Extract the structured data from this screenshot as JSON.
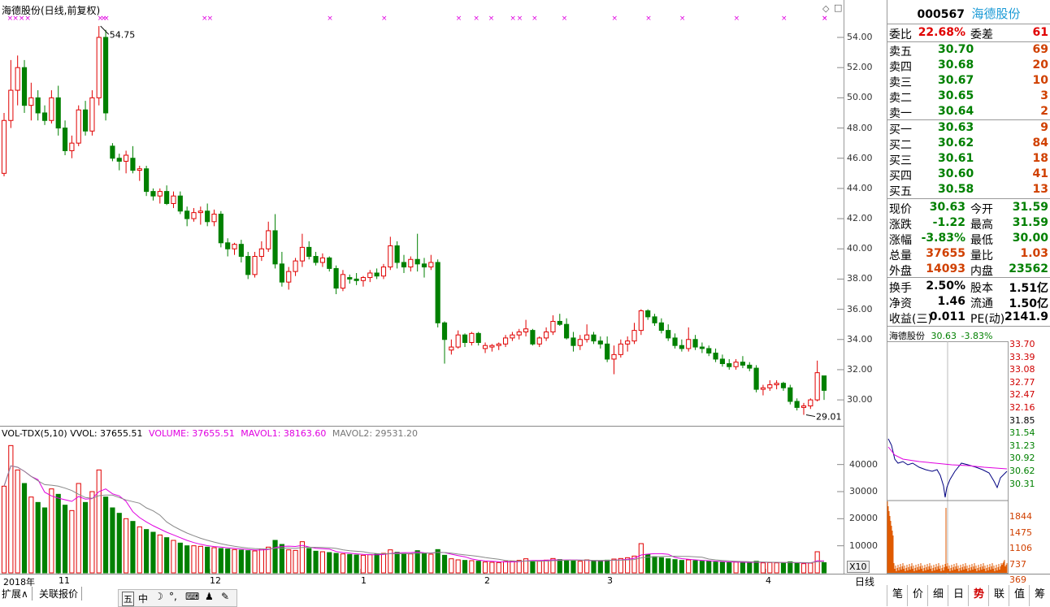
{
  "chart_header": {
    "title": "海德股份(日线,前复权)",
    "high_label": "54.75",
    "low_label": "29.01"
  },
  "indicator_header": {
    "name": "VOL-TDX(5,10)",
    "vvol": "VVOL: 37655.51",
    "volume": "VOLUME: 37655.51",
    "mavol1": "MAVOL1: 38163.60",
    "mavol2": "MAVOL2: 29531.20"
  },
  "colors": {
    "up": "#e00000",
    "down": "#008000",
    "ma1": "#e000e0",
    "ma2": "#888888",
    "grid": "#c8c8c8"
  },
  "price_axis": [
    "54.00",
    "52.00",
    "50.00",
    "48.00",
    "46.00",
    "44.00",
    "42.00",
    "40.00",
    "38.00",
    "36.00",
    "34.00",
    "32.00",
    "30.00"
  ],
  "volume_axis": [
    "40000",
    "30000",
    "20000",
    "10000"
  ],
  "volume_scale_badge": "X10",
  "time_axis": [
    "2018年",
    "11",
    "12",
    "1",
    "2",
    "3",
    "4"
  ],
  "period_label": "日线",
  "bottom_tabs": [
    "扩展∧",
    "关联报价"
  ],
  "toolbar_icons": [
    "五",
    "中",
    "moon-icon",
    "dots-icon",
    "keyboard-icon",
    "person-icon",
    "wrench-icon"
  ],
  "stock": {
    "code": "000567",
    "name": "海德股份"
  },
  "order_book": {
    "weibi_label": "委比",
    "weibi": "22.68%",
    "weicha_label": "委差",
    "weicha": "61",
    "asks": [
      {
        "label": "卖五",
        "price": "30.70",
        "vol": "69"
      },
      {
        "label": "卖四",
        "price": "30.68",
        "vol": "20"
      },
      {
        "label": "卖三",
        "price": "30.67",
        "vol": "10"
      },
      {
        "label": "卖二",
        "price": "30.65",
        "vol": "3"
      },
      {
        "label": "卖一",
        "price": "30.64",
        "vol": "2"
      }
    ],
    "bids": [
      {
        "label": "买一",
        "price": "30.63",
        "vol": "9"
      },
      {
        "label": "买二",
        "price": "30.62",
        "vol": "84"
      },
      {
        "label": "买三",
        "price": "30.61",
        "vol": "18"
      },
      {
        "label": "买四",
        "price": "30.60",
        "vol": "41"
      },
      {
        "label": "买五",
        "price": "30.58",
        "vol": "13"
      }
    ]
  },
  "quote": [
    {
      "l": "现价",
      "v": "30.63",
      "l2": "今开",
      "v2": "31.59"
    },
    {
      "l": "涨跌",
      "v": "-1.22",
      "l2": "最高",
      "v2": "31.59"
    },
    {
      "l": "涨幅",
      "v": "-3.83%",
      "l2": "最低",
      "v2": "30.00"
    },
    {
      "l": "总量",
      "v": "37655",
      "l2": "量比",
      "v2": "1.03"
    },
    {
      "l": "外盘",
      "v": "14093",
      "l2": "内盘",
      "v2": "23562"
    }
  ],
  "fundamentals": [
    {
      "l": "换手",
      "v": "2.50%",
      "l2": "股本",
      "v2": "1.51亿"
    },
    {
      "l": "净资",
      "v": "1.46",
      "l2": "流通",
      "v2": "1.50亿"
    },
    {
      "l": "收益(三)",
      "v": "0.011",
      "l2": "PE(动)",
      "v2": "2141.9"
    }
  ],
  "mini_chart": {
    "header_name": "海德股份",
    "header_value": "30.63",
    "header_change": "-3.83%",
    "price_ticks": [
      "33.70",
      "33.39",
      "33.08",
      "32.77",
      "32.47",
      "32.16",
      "31.85",
      "31.54",
      "31.23",
      "30.92",
      "30.62",
      "30.31"
    ],
    "vol_ticks": [
      "1844",
      "1475",
      "1106",
      "737",
      "369"
    ]
  },
  "right_tabs": [
    "笔",
    "价",
    "细",
    "日",
    "势",
    "联",
    "值",
    "筹"
  ],
  "active_right_tab": "势",
  "chart_data": {
    "type": "candlestick",
    "title": "海德股份(日线,前复权)",
    "ylim": [
      28.5,
      55.4
    ],
    "ohlc": [
      [
        45.0,
        49.0,
        44.8,
        48.5
      ],
      [
        48.5,
        52.5,
        48.0,
        50.5
      ],
      [
        50.5,
        52.8,
        49.5,
        52.0
      ],
      [
        52.0,
        52.5,
        49.0,
        49.5
      ],
      [
        49.5,
        51.0,
        48.5,
        50.0
      ],
      [
        50.0,
        50.5,
        48.5,
        49.0
      ],
      [
        49.0,
        49.5,
        48.2,
        48.5
      ],
      [
        48.5,
        50.5,
        48.3,
        50.0
      ],
      [
        50.0,
        50.8,
        47.5,
        48.0
      ],
      [
        48.0,
        48.5,
        46.2,
        46.5
      ],
      [
        46.5,
        47.5,
        46.0,
        47.0
      ],
      [
        47.0,
        49.5,
        46.8,
        49.2
      ],
      [
        49.2,
        49.8,
        47.5,
        47.8
      ],
      [
        47.8,
        50.5,
        47.5,
        50.0
      ],
      [
        50.0,
        54.75,
        49.5,
        54.0
      ],
      [
        54.0,
        54.5,
        48.5,
        49.0
      ],
      [
        46.8,
        47.0,
        45.8,
        46.0
      ],
      [
        46.0,
        46.3,
        45.2,
        45.8
      ],
      [
        45.8,
        46.5,
        45.0,
        46.2
      ],
      [
        46.0,
        46.8,
        45.0,
        45.2
      ],
      [
        45.2,
        45.5,
        44.5,
        45.3
      ],
      [
        45.3,
        45.5,
        43.5,
        43.8
      ],
      [
        43.8,
        44.0,
        43.2,
        43.5
      ],
      [
        43.5,
        44.0,
        43.0,
        43.8
      ],
      [
        43.8,
        44.2,
        42.9,
        43.0
      ],
      [
        43.0,
        43.8,
        42.7,
        43.5
      ],
      [
        43.5,
        43.8,
        42.3,
        42.5
      ],
      [
        42.5,
        42.8,
        41.5,
        42.0
      ],
      [
        42.0,
        42.7,
        41.8,
        42.4
      ],
      [
        42.4,
        42.8,
        41.6,
        42.5
      ],
      [
        42.5,
        43.0,
        41.5,
        41.8
      ],
      [
        41.8,
        42.6,
        41.5,
        42.3
      ],
      [
        42.3,
        42.5,
        40.1,
        40.4
      ],
      [
        40.4,
        40.7,
        39.5,
        40.0
      ],
      [
        40.0,
        40.4,
        39.6,
        40.3
      ],
      [
        40.3,
        40.6,
        39.1,
        39.5
      ],
      [
        39.5,
        39.8,
        38.0,
        38.3
      ],
      [
        38.3,
        39.8,
        38.1,
        39.5
      ],
      [
        39.5,
        40.5,
        39.2,
        40.0
      ],
      [
        40.0,
        41.8,
        39.8,
        41.2
      ],
      [
        41.2,
        42.3,
        38.7,
        39.0
      ],
      [
        39.0,
        39.8,
        37.5,
        37.8
      ],
      [
        37.8,
        38.8,
        37.3,
        38.5
      ],
      [
        38.5,
        39.4,
        38.2,
        39.2
      ],
      [
        39.2,
        41.0,
        38.8,
        40.1
      ],
      [
        40.1,
        40.5,
        39.3,
        39.5
      ],
      [
        39.5,
        39.8,
        38.9,
        39.1
      ],
      [
        39.1,
        39.7,
        38.8,
        39.4
      ],
      [
        39.4,
        39.5,
        38.5,
        38.7
      ],
      [
        38.7,
        38.9,
        37.0,
        37.4
      ],
      [
        37.4,
        38.6,
        37.2,
        38.3
      ],
      [
        38.1,
        38.3,
        37.7,
        38.0
      ],
      [
        38.0,
        38.4,
        37.6,
        37.9
      ],
      [
        37.9,
        38.2,
        37.5,
        38.1
      ],
      [
        38.1,
        38.6,
        37.8,
        38.4
      ],
      [
        38.4,
        38.7,
        38.0,
        38.2
      ],
      [
        38.2,
        39.0,
        38.0,
        38.8
      ],
      [
        38.8,
        40.8,
        38.6,
        40.2
      ],
      [
        40.2,
        40.5,
        38.7,
        39.1
      ],
      [
        39.1,
        39.6,
        38.4,
        38.8
      ],
      [
        38.8,
        39.5,
        38.5,
        39.3
      ],
      [
        39.3,
        41.0,
        38.5,
        39.0
      ],
      [
        39.0,
        39.4,
        38.1,
        38.8
      ],
      [
        38.8,
        39.6,
        38.6,
        39.1
      ],
      [
        39.1,
        39.3,
        34.8,
        35.1
      ],
      [
        35.1,
        35.2,
        32.4,
        34.0
      ],
      [
        33.3,
        34.0,
        33.0,
        33.5
      ],
      [
        33.5,
        34.6,
        33.4,
        34.3
      ],
      [
        34.3,
        34.4,
        33.5,
        33.8
      ],
      [
        33.8,
        34.5,
        33.6,
        34.4
      ],
      [
        34.4,
        34.5,
        33.6,
        33.8
      ],
      [
        33.4,
        33.8,
        33.1,
        33.6
      ],
      [
        33.5,
        33.7,
        33.2,
        33.6
      ],
      [
        33.6,
        33.8,
        33.3,
        33.7
      ],
      [
        33.7,
        34.3,
        33.5,
        34.1
      ],
      [
        34.1,
        34.5,
        33.9,
        34.3
      ],
      [
        34.3,
        34.7,
        34.0,
        34.5
      ],
      [
        34.5,
        35.3,
        34.2,
        34.7
      ],
      [
        34.6,
        34.7,
        33.6,
        33.7
      ],
      [
        33.7,
        34.2,
        33.5,
        34.1
      ],
      [
        34.1,
        34.8,
        33.9,
        34.5
      ],
      [
        34.5,
        35.6,
        34.3,
        35.2
      ],
      [
        35.2,
        35.7,
        34.9,
        35.0
      ],
      [
        35.0,
        35.4,
        34.0,
        34.1
      ],
      [
        34.1,
        34.5,
        33.2,
        33.6
      ],
      [
        33.6,
        34.3,
        33.3,
        34.0
      ],
      [
        34.0,
        35.0,
        33.8,
        34.3
      ],
      [
        34.3,
        34.5,
        33.7,
        33.9
      ],
      [
        33.9,
        34.2,
        33.4,
        33.7
      ],
      [
        33.7,
        34.2,
        32.5,
        32.7
      ],
      [
        32.7,
        33.6,
        31.7,
        33.0
      ],
      [
        33.0,
        34.0,
        32.8,
        33.7
      ],
      [
        33.7,
        34.2,
        33.2,
        33.9
      ],
      [
        33.9,
        35.1,
        33.7,
        34.6
      ],
      [
        34.6,
        36.0,
        34.3,
        35.9
      ],
      [
        35.9,
        36.0,
        35.3,
        35.5
      ],
      [
        35.5,
        35.7,
        34.9,
        35.1
      ],
      [
        35.1,
        35.4,
        34.4,
        34.6
      ],
      [
        34.6,
        35.0,
        33.9,
        34.1
      ],
      [
        34.1,
        34.4,
        33.4,
        33.6
      ],
      [
        33.6,
        34.0,
        33.2,
        33.4
      ],
      [
        33.4,
        34.8,
        33.2,
        34.0
      ],
      [
        34.0,
        34.3,
        33.3,
        33.5
      ],
      [
        33.5,
        33.8,
        33.1,
        33.4
      ],
      [
        33.4,
        33.6,
        32.9,
        33.1
      ],
      [
        33.1,
        33.4,
        32.5,
        32.7
      ],
      [
        32.7,
        33.0,
        32.2,
        32.4
      ],
      [
        32.4,
        32.7,
        32.0,
        32.2
      ],
      [
        32.2,
        32.7,
        32.0,
        32.5
      ],
      [
        32.5,
        32.9,
        32.1,
        32.3
      ],
      [
        32.3,
        32.5,
        31.9,
        32.1
      ],
      [
        32.1,
        32.3,
        30.5,
        30.7
      ],
      [
        30.7,
        31.0,
        30.3,
        30.8
      ],
      [
        30.8,
        31.3,
        30.6,
        31.0
      ],
      [
        31.0,
        31.3,
        30.7,
        31.1
      ],
      [
        31.1,
        31.2,
        30.6,
        30.8
      ],
      [
        30.8,
        31.0,
        29.7,
        29.9
      ],
      [
        29.9,
        30.1,
        29.3,
        29.5
      ],
      [
        29.5,
        29.8,
        29.01,
        29.6
      ],
      [
        29.6,
        30.1,
        29.4,
        30.0
      ],
      [
        30.0,
        32.6,
        29.9,
        31.8
      ],
      [
        31.59,
        31.59,
        30.0,
        30.63
      ]
    ],
    "volume": [
      32000,
      47000,
      38000,
      33000,
      28000,
      26000,
      24000,
      31000,
      29000,
      25000,
      23000,
      33000,
      26000,
      30000,
      38000,
      28000,
      24000,
      22000,
      20000,
      19000,
      17000,
      16000,
      15000,
      14000,
      13000,
      12000,
      11000,
      10000,
      10000,
      9800,
      9500,
      9300,
      9000,
      8800,
      8600,
      8400,
      8200,
      8100,
      8800,
      9500,
      12000,
      10500,
      8500,
      8300,
      11500,
      9000,
      8000,
      7800,
      7500,
      7200,
      7000,
      6800,
      6600,
      6500,
      6700,
      6900,
      7200,
      8500,
      7600,
      7100,
      7000,
      8200,
      7300,
      6900,
      8600,
      6500,
      5200,
      4800,
      4600,
      4500,
      4300,
      4000,
      3900,
      3800,
      4200,
      4400,
      4600,
      5200,
      4500,
      4300,
      4700,
      5300,
      4900,
      4600,
      4400,
      4300,
      4800,
      4500,
      4300,
      4700,
      5100,
      5300,
      5600,
      6200,
      10800,
      6800,
      6000,
      5600,
      5200,
      4900,
      4600,
      4800,
      4500,
      4300,
      4200,
      4000,
      3900,
      3800,
      4000,
      3900,
      3800,
      4300,
      3700,
      3800,
      3700,
      3600,
      4100,
      3500,
      3400,
      3600,
      7800,
      3766
    ]
  }
}
